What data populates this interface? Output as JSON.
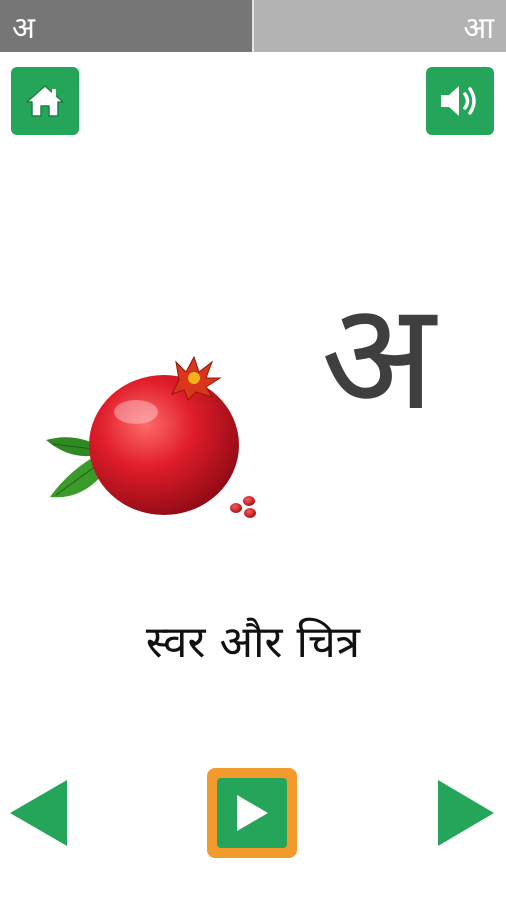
{
  "tabs": {
    "current": "अ",
    "next": "आ"
  },
  "main": {
    "letter": "अ",
    "caption": "स्वर और चित्र"
  },
  "icons": {
    "home": "home-icon",
    "sound": "speaker-icon",
    "prev": "triangle-left-icon",
    "next": "triangle-right-icon",
    "play": "play-icon",
    "picture": "pomegranate-illustration"
  },
  "colors": {
    "accent_green": "#25a55a",
    "play_border": "#f39a2d",
    "tab_active": "#767676",
    "tab_inactive": "#b3b3b3"
  }
}
